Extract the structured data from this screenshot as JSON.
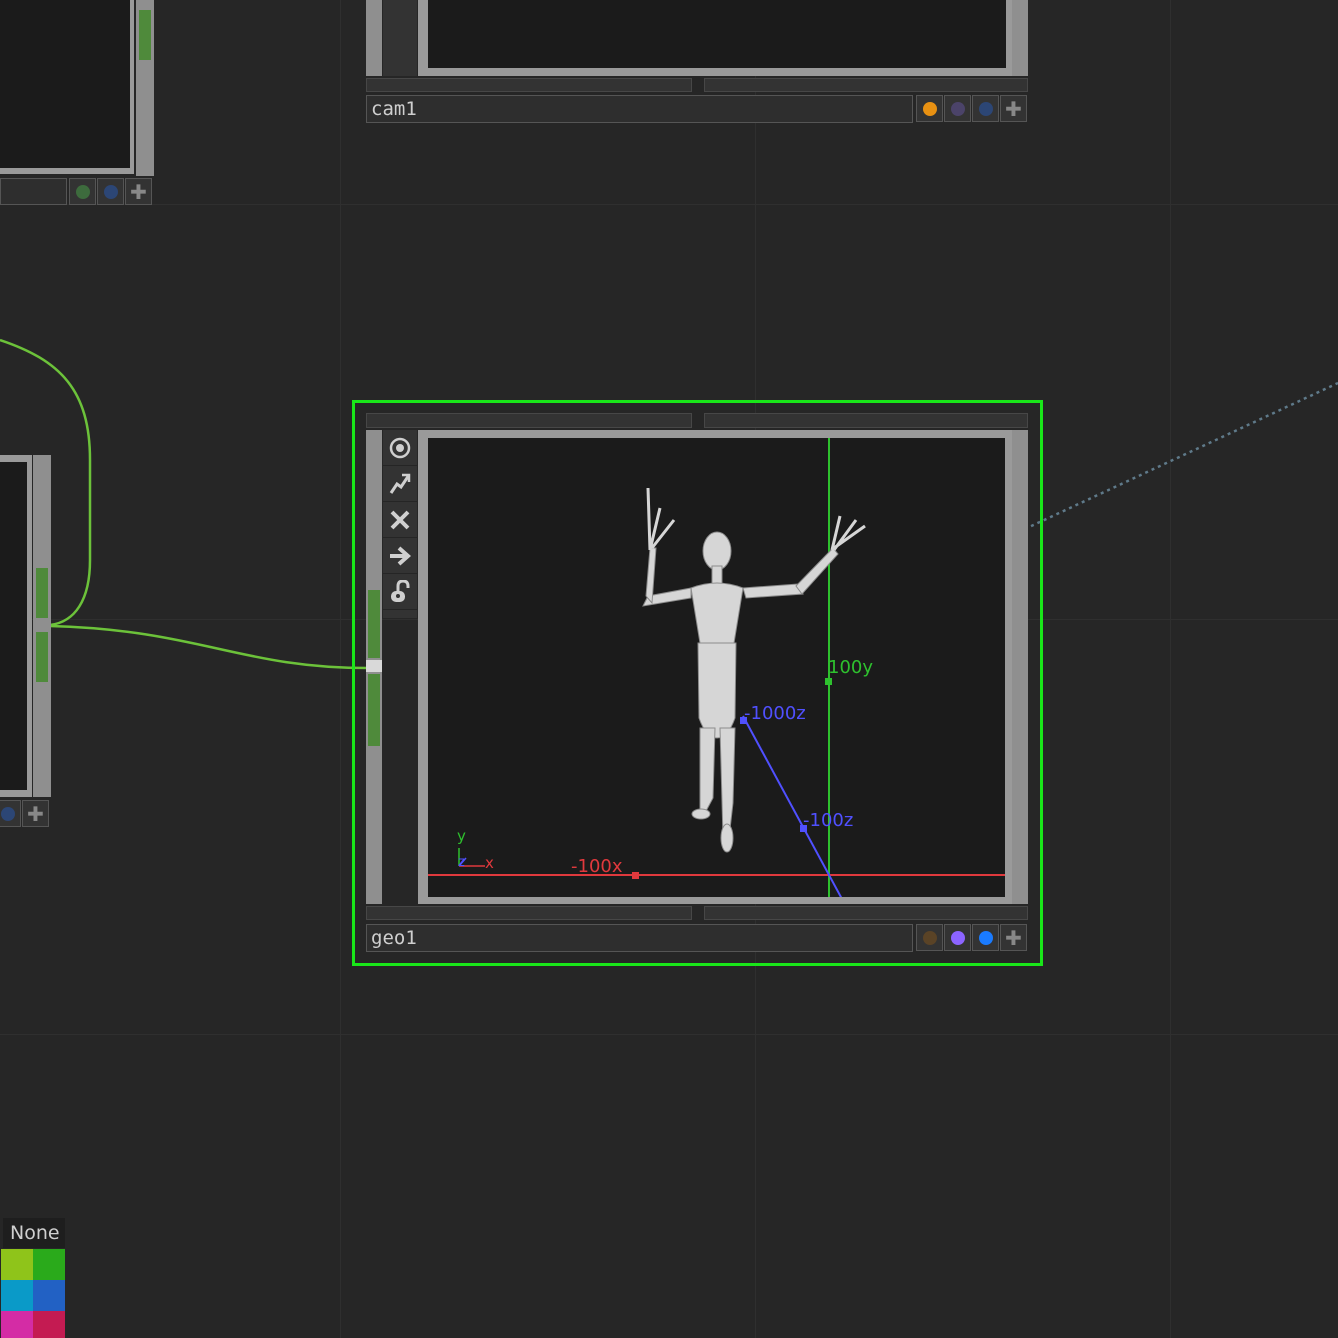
{
  "nodes": {
    "cam1": {
      "name": "cam1",
      "flag_colors": [
        "#e89112",
        "#4b4369",
        "#2c4675"
      ]
    },
    "geo1": {
      "name": "geo1",
      "flag_colors": [
        "#5a4326",
        "#8c64ff",
        "#1a7bff"
      ]
    },
    "left_top": {
      "flag_colors": [
        "#3d6b3d",
        "#2c4675"
      ]
    },
    "left_mid": {
      "flag_colors": [
        "#2c4675"
      ]
    }
  },
  "geo1_viewer": {
    "axis_labels": {
      "x_neg": "-100x",
      "y_pos": "100y",
      "z_far": "-1000z",
      "z_near": "-100z"
    },
    "gizmo": {
      "x": "x",
      "y": "y",
      "z": "z"
    },
    "colors": {
      "x_axis": "#e0393d",
      "y_axis": "#2ec12e",
      "z_axis": "#5050ff"
    }
  },
  "toolbar": {
    "icons": [
      "viewer-icon",
      "bypass-icon",
      "cooking-off-icon",
      "export-arrow-icon",
      "lock-icon"
    ]
  },
  "color_picker": {
    "none_label": "None",
    "swatches": [
      "#8fc41a",
      "#2aaa1b",
      "#0a9ac8",
      "#2261c4",
      "#d42ca5",
      "#c41b52"
    ]
  },
  "selection_color": "#19e619"
}
